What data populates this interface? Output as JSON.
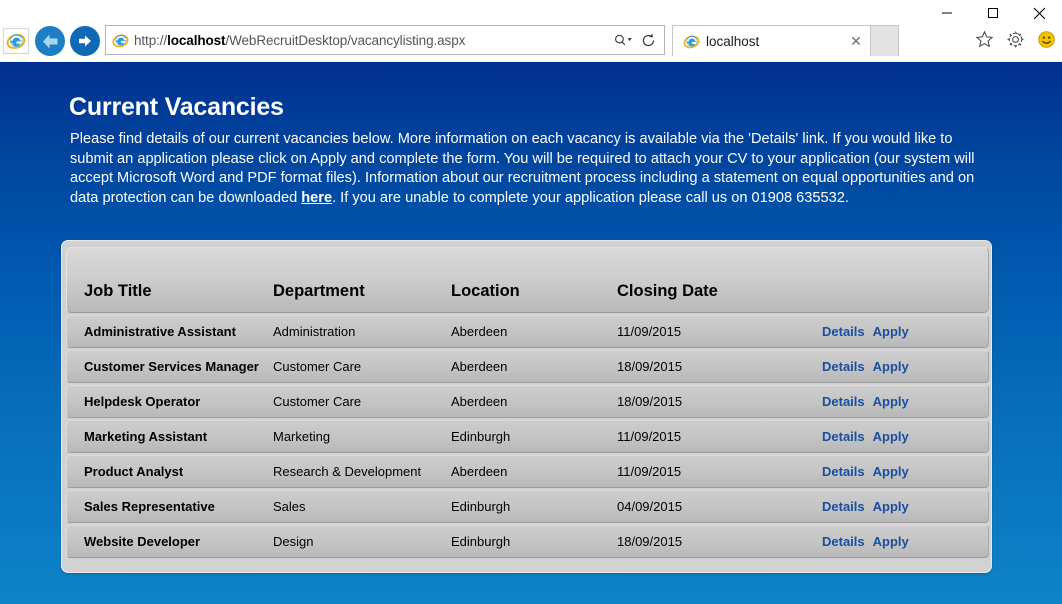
{
  "browser": {
    "address_value": "http://localhost/WebRecruitDesktop/vacancylisting.aspx",
    "address_host": "localhost",
    "address_prefix": "http://",
    "address_suffix": "/WebRecruitDesktop/vacancylisting.aspx",
    "tab_title": "localhost",
    "tab_close_glyph": "✕",
    "minimize_label": "Minimize",
    "maximize_label": "Maximize",
    "close_label": "Close",
    "back_label": "Back",
    "forward_label": "Forward",
    "search_label": "Search",
    "refresh_label": "Refresh",
    "new_tab_label": "New tab",
    "favorites_label": "Favorites",
    "tools_label": "Tools",
    "feedback_label": "Send a smile feedback"
  },
  "page": {
    "title": "Current Vacancies",
    "intro_part1": "Please find details of our current vacancies below. More information on each vacancy is available via the 'Details' link. If you would like to submit an application please click on Apply and complete the form. You will be required to attach your CV to your application (our system will accept Microsoft Word and PDF format files). Information about our recruitment process including a statement on equal opportunities and on data protection can be downloaded ",
    "intro_link": "here",
    "intro_part2": ". If you are unable to complete your application please call us on 01908 635532."
  },
  "table": {
    "columns": [
      "Job Title",
      "Department",
      "Location",
      "Closing Date",
      ""
    ],
    "details_label": "Details",
    "apply_label": "Apply",
    "rows": [
      {
        "title": "Administrative Assistant",
        "department": "Administration",
        "location": "Aberdeen",
        "closing_date": "11/09/2015"
      },
      {
        "title": "Customer Services Manager",
        "department": "Customer Care",
        "location": "Aberdeen",
        "closing_date": "18/09/2015"
      },
      {
        "title": "Helpdesk Operator",
        "department": "Customer Care",
        "location": "Aberdeen",
        "closing_date": "18/09/2015"
      },
      {
        "title": "Marketing Assistant",
        "department": "Marketing",
        "location": "Edinburgh",
        "closing_date": "11/09/2015"
      },
      {
        "title": "Product Analyst",
        "department": "Research & Development",
        "location": "Aberdeen",
        "closing_date": "11/09/2015"
      },
      {
        "title": "Sales Representative",
        "department": "Sales",
        "location": "Edinburgh",
        "closing_date": "04/09/2015"
      },
      {
        "title": "Website Developer",
        "department": "Design",
        "location": "Edinburgh",
        "closing_date": "18/09/2015"
      }
    ]
  },
  "colors": {
    "page_bg_top": "#00308f",
    "page_bg_bottom": "#0e83c8",
    "link_blue": "#1a4fa0",
    "panel_gray": "#d2d2d2",
    "row_gray": "#c4c4c4"
  }
}
